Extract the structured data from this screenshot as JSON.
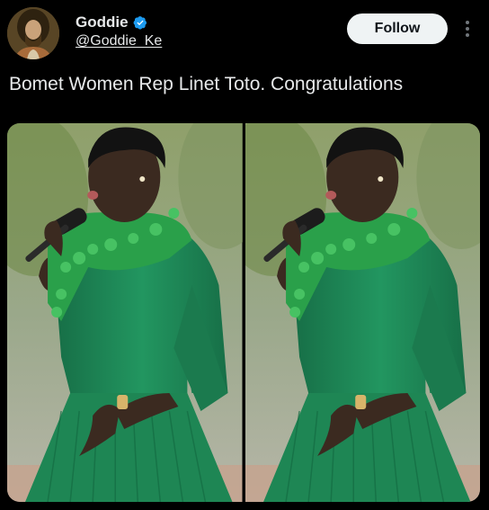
{
  "author": {
    "display_name": "Goddie",
    "handle": "@Goddie_Ke",
    "verified": true,
    "avatar_icon": "portrait-avatar"
  },
  "actions": {
    "follow_label": "Follow",
    "more_icon": "more-vertical-icon"
  },
  "tweet": {
    "text": "Bomet Women Rep Linet Toto. Congratulations"
  },
  "media": {
    "count": 2
  },
  "colors": {
    "background": "#000000",
    "text": "#e7e9ea",
    "verified": "#1d9bf0",
    "follow_bg": "#eff3f4",
    "dress_green": "#1f8a5a"
  }
}
